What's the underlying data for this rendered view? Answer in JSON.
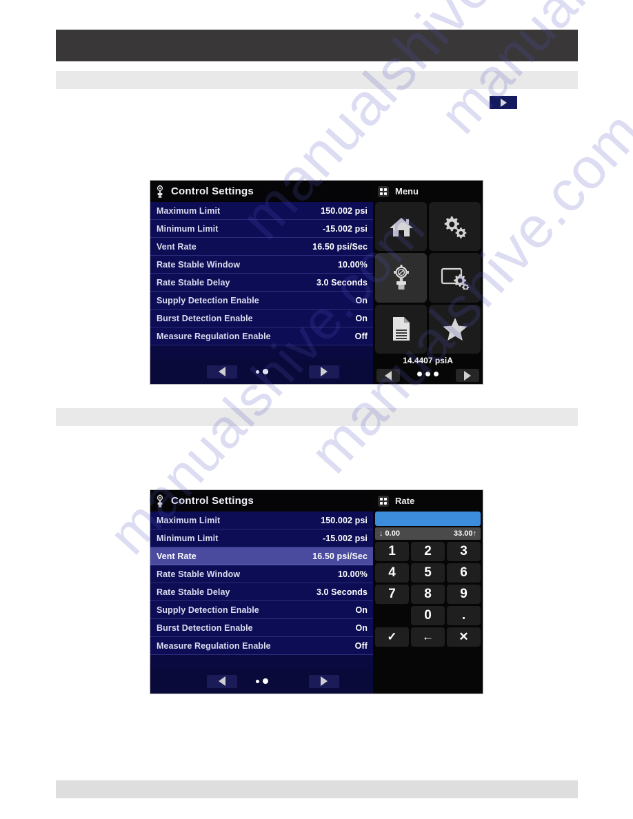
{
  "document": {
    "header_bar_color": "#3a3738",
    "section_bar_color": "#e9e9e9",
    "watermark_text": "manualshive.com"
  },
  "nav_button": {
    "name": "next-page-button",
    "glyph": "play-triangle",
    "color": "#131a5e"
  },
  "screens": [
    {
      "id": "screen-menu",
      "left_panel": {
        "title": "Control Settings",
        "title_icon": "pressure-regulator-icon",
        "rows": [
          {
            "label": "Maximum Limit",
            "value": "150.002 psi",
            "selected": false
          },
          {
            "label": "Minimum Limit",
            "value": "-15.002 psi",
            "selected": false
          },
          {
            "label": "Vent Rate",
            "value": "16.50 psi/Sec",
            "selected": false
          },
          {
            "label": "Rate Stable Window",
            "value": "10.00%",
            "selected": false
          },
          {
            "label": "Rate Stable Delay",
            "value": "3.0 Seconds",
            "selected": false
          },
          {
            "label": "Supply Detection Enable",
            "value": "On",
            "selected": false
          },
          {
            "label": "Burst Detection Enable",
            "value": "On",
            "selected": false
          },
          {
            "label": "Measure Regulation Enable",
            "value": "Off",
            "selected": false
          }
        ],
        "footer": {
          "prev_icon": "left-triangle-icon",
          "next_icon": "right-triangle-icon",
          "page_dots": 2,
          "active_dot_index": 1
        }
      },
      "right_panel": {
        "type": "menu",
        "title": "Menu",
        "grip_icon": "grip-dots-icon",
        "tiles": [
          {
            "icon": "home-icon",
            "highlight": false
          },
          {
            "icon": "gears-settings-icon",
            "highlight": false
          },
          {
            "icon": "pressure-regulator-icon",
            "highlight": true
          },
          {
            "icon": "display-settings-icon",
            "highlight": false
          },
          {
            "icon": "document-log-icon",
            "highlight": false
          },
          {
            "icon": "star-favorites-icon",
            "highlight": false
          }
        ],
        "readout": "14.4407 psiA",
        "footer": {
          "prev_icon": "left-triangle-icon",
          "next_icon": "right-triangle-icon",
          "page_dots": 3
        }
      }
    },
    {
      "id": "screen-keypad",
      "left_panel": {
        "title": "Control Settings",
        "title_icon": "pressure-regulator-icon",
        "rows": [
          {
            "label": "Maximum Limit",
            "value": "150.002 psi",
            "selected": false
          },
          {
            "label": "Minimum Limit",
            "value": "-15.002 psi",
            "selected": false
          },
          {
            "label": "Vent Rate",
            "value": "16.50 psi/Sec",
            "selected": true
          },
          {
            "label": "Rate Stable Window",
            "value": "10.00%",
            "selected": false
          },
          {
            "label": "Rate Stable Delay",
            "value": "3.0 Seconds",
            "selected": false
          },
          {
            "label": "Supply Detection Enable",
            "value": "On",
            "selected": false
          },
          {
            "label": "Burst Detection Enable",
            "value": "On",
            "selected": false
          },
          {
            "label": "Measure Regulation Enable",
            "value": "Off",
            "selected": false
          }
        ],
        "footer": {
          "prev_icon": "left-triangle-icon",
          "next_icon": "right-triangle-icon",
          "page_dots": 2,
          "active_dot_index": 1
        }
      },
      "right_panel": {
        "type": "keypad",
        "title": "Rate",
        "grip_icon": "grip-dots-icon",
        "entry_value": "",
        "entry_field_color": "#3d8ddd",
        "range": {
          "min_arrow": "↓",
          "min": "0.00",
          "max": "33.00",
          "max_arrow": "↑"
        },
        "keys": [
          {
            "label": "1",
            "name": "key-1"
          },
          {
            "label": "2",
            "name": "key-2"
          },
          {
            "label": "3",
            "name": "key-3"
          },
          {
            "label": "4",
            "name": "key-4"
          },
          {
            "label": "5",
            "name": "key-5"
          },
          {
            "label": "6",
            "name": "key-6"
          },
          {
            "label": "7",
            "name": "key-7"
          },
          {
            "label": "8",
            "name": "key-8"
          },
          {
            "label": "9",
            "name": "key-9"
          },
          {
            "label": "",
            "name": "key-blank"
          },
          {
            "label": "0",
            "name": "key-0"
          },
          {
            "label": ".",
            "name": "key-decimal"
          },
          {
            "label": "✓",
            "name": "key-accept"
          },
          {
            "label": "←",
            "name": "key-backspace"
          },
          {
            "label": "✕",
            "name": "key-cancel"
          }
        ]
      }
    }
  ]
}
